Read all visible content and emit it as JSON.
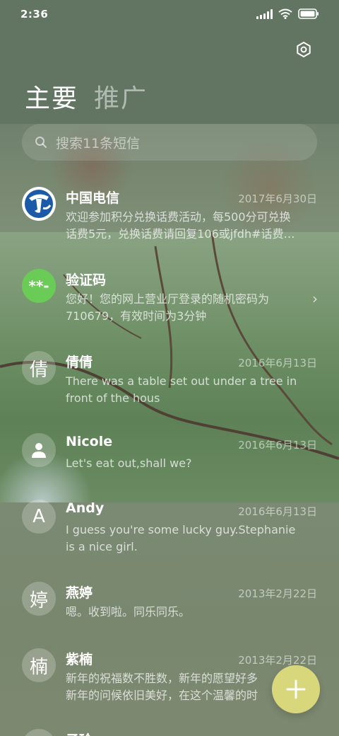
{
  "status_bar": {
    "time": "2:36"
  },
  "tabs": [
    {
      "label": "主要",
      "active": true
    },
    {
      "label": "推广",
      "active": false
    }
  ],
  "search": {
    "placeholder": "搜索11条短信"
  },
  "messages": [
    {
      "name": "中国电信",
      "date": "2017年6月30日",
      "line1": "欢迎参加积分兑换话费活动，每500分可兑换",
      "line2": "话费5元，兑换话费请回复106或jfdh#话费…",
      "avatar": "china-telecom-logo"
    },
    {
      "name": "验证码",
      "date": "",
      "line1": "您好！您的网上营业厅登录的随机密码为",
      "line2": "710679，有效时间为3分钟",
      "avatar_text": "**-"
    },
    {
      "name": "倩倩",
      "date": "2016年6月13日",
      "line1": "There was a table set out under a tree in",
      "line2": "front of the hous",
      "avatar_text": "倩"
    },
    {
      "name": "Nicole",
      "date": "2016年6月13日",
      "line1": "Let's eat out,shall we?",
      "line2": "",
      "avatar": "person-icon"
    },
    {
      "name": "Andy",
      "date": "2016年6月13日",
      "line1": "I guess you're some lucky guy.Stephanie",
      "line2": "is a nice girl.",
      "avatar_text": "A"
    },
    {
      "name": "燕婷",
      "date": "2013年2月22日",
      "line1": "嗯。收到啦。同乐同乐。",
      "line2": "",
      "avatar_text": "婷"
    },
    {
      "name": "紫楠",
      "date": "2013年2月22日",
      "line1": "新年的祝福数不胜数，新年的愿望好多",
      "line2": "新年的问候依旧美好，在这个温馨的时",
      "avatar_text": "楠"
    },
    {
      "name": "子玲",
      "date": "",
      "line1": "",
      "line2": ""
    }
  ],
  "colors": {
    "accent_fab": "#d8d77c",
    "verify_avatar": "#6acb57",
    "telecom_blue": "#1a5aa8"
  }
}
